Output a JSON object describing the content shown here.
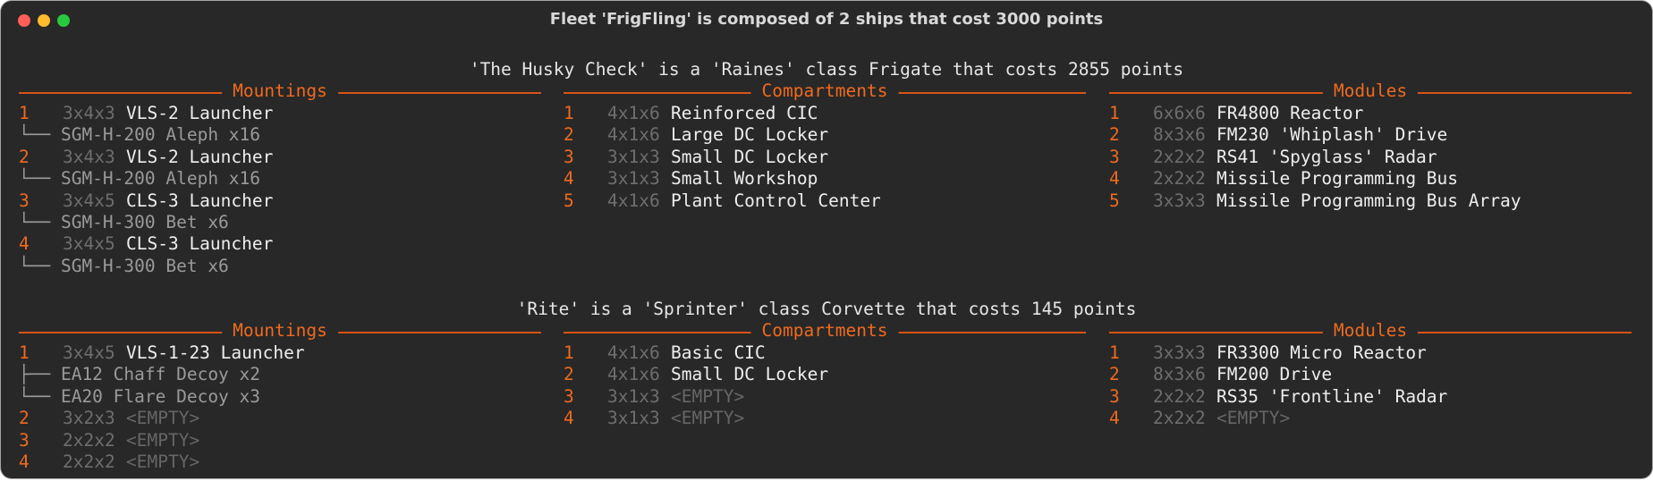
{
  "window": {
    "title": "Fleet 'FrigFling' is composed of 2 ships that cost 3000 points"
  },
  "section_titles": {
    "mountings": "Mountings",
    "compartments": "Compartments",
    "modules": "Modules"
  },
  "ships": [
    {
      "header": "'The Husky Check' is a 'Raines' class Frigate that costs 2855 points",
      "mountings": [
        {
          "num": "1",
          "size": "3x4x3",
          "name": "VLS-2 Launcher",
          "subs": [
            "└── SGM-H-200 Aleph x16"
          ]
        },
        {
          "num": "2",
          "size": "3x4x3",
          "name": "VLS-2 Launcher",
          "subs": [
            "└── SGM-H-200 Aleph x16"
          ]
        },
        {
          "num": "3",
          "size": "3x4x5",
          "name": "CLS-3 Launcher",
          "subs": [
            "└── SGM-H-300 Bet x6"
          ]
        },
        {
          "num": "4",
          "size": "3x4x5",
          "name": "CLS-3 Launcher",
          "subs": [
            "└── SGM-H-300 Bet x6"
          ]
        }
      ],
      "compartments": [
        {
          "num": "1",
          "size": "4x1x6",
          "name": "Reinforced CIC"
        },
        {
          "num": "2",
          "size": "4x1x6",
          "name": "Large DC Locker"
        },
        {
          "num": "3",
          "size": "3x1x3",
          "name": "Small DC Locker"
        },
        {
          "num": "4",
          "size": "3x1x3",
          "name": "Small Workshop"
        },
        {
          "num": "5",
          "size": "4x1x6",
          "name": "Plant Control Center"
        }
      ],
      "modules": [
        {
          "num": "1",
          "size": "6x6x6",
          "name": "FR4800 Reactor"
        },
        {
          "num": "2",
          "size": "8x3x6",
          "name": "FM230 'Whiplash' Drive"
        },
        {
          "num": "3",
          "size": "2x2x2",
          "name": "RS41 'Spyglass' Radar"
        },
        {
          "num": "4",
          "size": "2x2x2",
          "name": "Missile Programming Bus"
        },
        {
          "num": "5",
          "size": "3x3x3",
          "name": "Missile Programming Bus Array"
        }
      ]
    },
    {
      "header": "'Rite' is a 'Sprinter' class Corvette that costs 145 points",
      "mountings": [
        {
          "num": "1",
          "size": "3x4x5",
          "name": "VLS-1-23 Launcher",
          "subs": [
            "├── EA12 Chaff Decoy x2",
            "└── EA20 Flare Decoy x3"
          ]
        },
        {
          "num": "2",
          "size": "3x2x3",
          "name": "<EMPTY>",
          "empty": true,
          "subs": []
        },
        {
          "num": "3",
          "size": "2x2x2",
          "name": "<EMPTY>",
          "empty": true,
          "subs": []
        },
        {
          "num": "4",
          "size": "2x2x2",
          "name": "<EMPTY>",
          "empty": true,
          "subs": []
        }
      ],
      "compartments": [
        {
          "num": "1",
          "size": "4x1x6",
          "name": "Basic CIC"
        },
        {
          "num": "2",
          "size": "4x1x6",
          "name": "Small DC Locker"
        },
        {
          "num": "3",
          "size": "3x1x3",
          "name": "<EMPTY>",
          "empty": true
        },
        {
          "num": "4",
          "size": "3x1x3",
          "name": "<EMPTY>",
          "empty": true
        }
      ],
      "modules": [
        {
          "num": "1",
          "size": "3x3x3",
          "name": "FR3300 Micro Reactor"
        },
        {
          "num": "2",
          "size": "8x3x6",
          "name": "FM200 Drive"
        },
        {
          "num": "3",
          "size": "2x2x2",
          "name": "RS35 'Frontline' Radar"
        },
        {
          "num": "4",
          "size": "2x2x2",
          "name": "<EMPTY>",
          "empty": true
        }
      ]
    }
  ],
  "colors": {
    "background": "#282828",
    "accent": "#ee6a1f",
    "rule": "#d85316",
    "text": "#eeeeee",
    "dim": "#6e6e6e",
    "sub_item": "#9a9a9a",
    "empty": "#666666"
  }
}
